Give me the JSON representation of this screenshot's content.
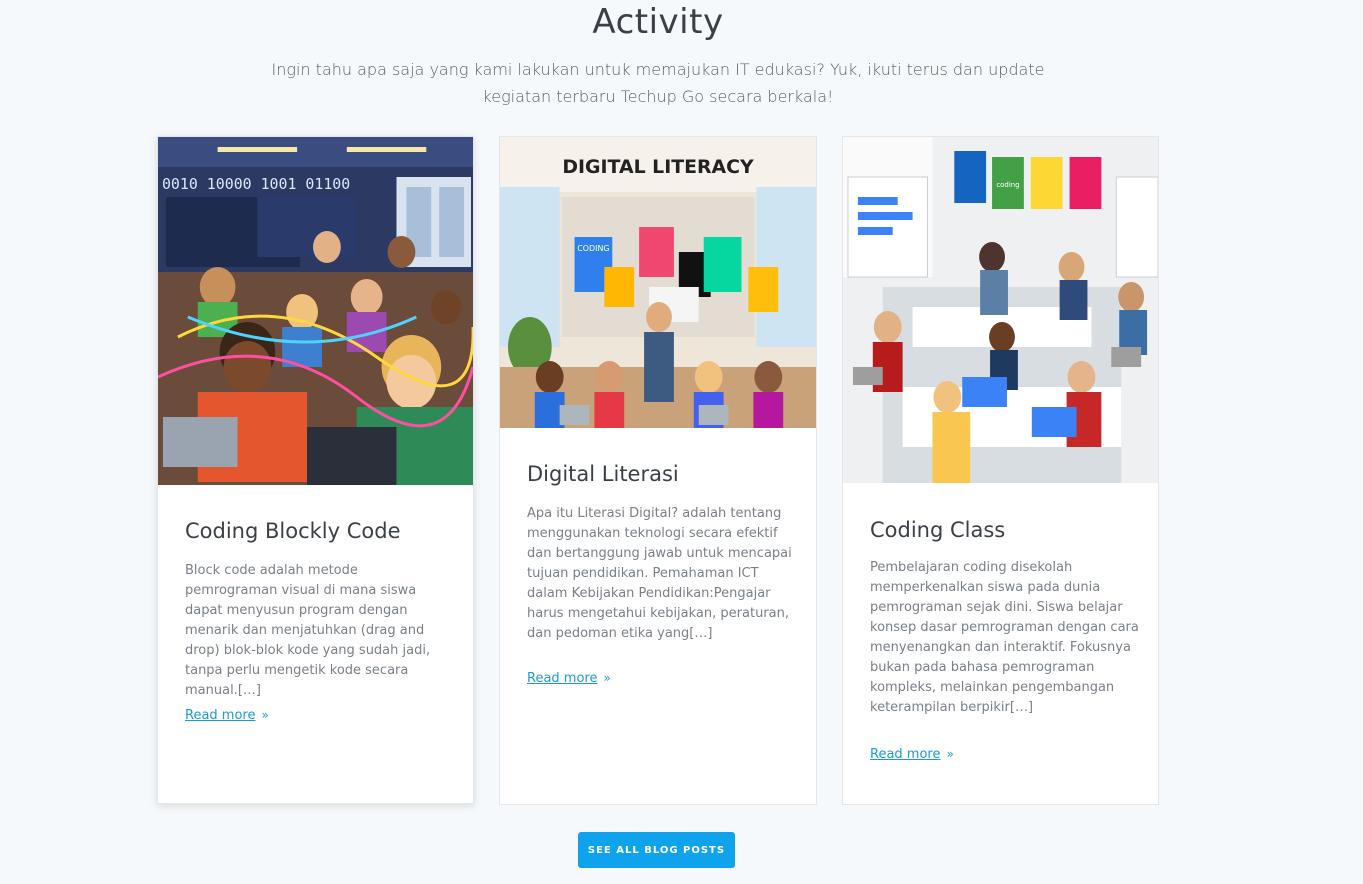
{
  "section": {
    "title": "Activity",
    "subtitle": "Ingin tahu apa saja yang kami lakukan untuk memajukan IT edukasi? Yuk, ikuti terus dan update kegiatan terbaru Techup Go secara berkala!"
  },
  "posts": [
    {
      "title": "Coding Blockly Code",
      "excerpt": "Block code adalah metode pemrograman visual di mana siswa dapat menyusun program dengan menarik dan menjatuhkan (drag and drop) blok-blok kode yang sudah jadi, tanpa perlu mengetik kode secara manual.[…]",
      "read_more": "Read more",
      "image_text": "0010 10000 1001 01100"
    },
    {
      "title": "Digital Literasi",
      "excerpt": "Apa itu Literasi Digital? adalah tentang menggunakan teknologi secara efektif dan bertanggung jawab untuk mencapai tujuan pendidikan. Pemahaman ICT dalam Kebijakan Pendidikan:Pengajar harus mengetahui kebijakan, peraturan, dan pedoman etika yang[…]",
      "read_more": "Read more",
      "image_text": "DIGITAL LITERACY",
      "poster_text": "CODING"
    },
    {
      "title": "Coding Class",
      "excerpt": "Pembelajaran coding  disekolah memperkenalkan siswa pada dunia pemrograman sejak dini. Siswa belajar konsep dasar pemrograman dengan cara menyenangkan dan interaktif. Fokusnya bukan pada bahasa pemrograman kompleks, melainkan pengembangan keterampilan berpikir[…]",
      "read_more": "Read more",
      "image_text": "coding"
    }
  ],
  "cta": {
    "label": "SEE ALL BLOG POSTS"
  },
  "colors": {
    "accent": "#0fa3ee",
    "link": "#1a9bd7",
    "background": "#f5f9fc"
  },
  "icons": {
    "read_more": "chevron-double-right-icon"
  }
}
